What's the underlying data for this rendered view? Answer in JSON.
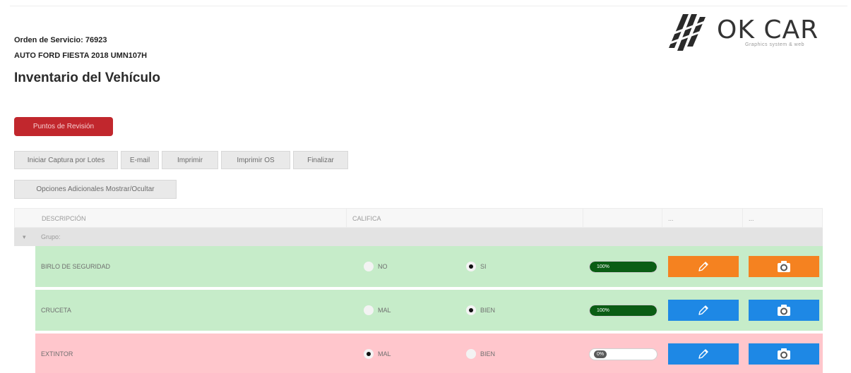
{
  "header": {
    "order": "Orden de Servicio: 76923",
    "vehicle": "AUTO FORD FIESTA 2018 UMN107H",
    "title": "Inventario del Vehículo"
  },
  "logo": {
    "name": "OK CAR",
    "tagline": "Graphics system & web"
  },
  "buttons": {
    "primary": "Puntos de Revisión",
    "toolbar": [
      "Iniciar Captura por Lotes",
      "E-mail",
      "Imprimir",
      "Imprimir OS",
      "Finalizar"
    ],
    "options": "Opciones Adicionales Mostrar/Ocultar"
  },
  "grid": {
    "columns": [
      "DESCRIPCIÓN",
      "CALIFICA",
      "",
      "...",
      "..."
    ],
    "group": {
      "toggle": "▾",
      "label": "Grupo:"
    },
    "rows": [
      {
        "description": "BIRLO DE SEGURIDAD",
        "option1": "NO",
        "option2": "SI",
        "selected": 2,
        "progress": 100,
        "progress_label": "100%",
        "status": "ok",
        "edit_color": "#f58220",
        "camera_color": "#f58220"
      },
      {
        "description": "CRUCETA",
        "option1": "MAL",
        "option2": "BIEN",
        "selected": 2,
        "progress": 100,
        "progress_label": "100%",
        "status": "ok",
        "edit_color": "#1e88e5",
        "camera_color": "#1e88e5"
      },
      {
        "description": "EXTINTOR",
        "option1": "MAL",
        "option2": "BIEN",
        "selected": 1,
        "progress": 0,
        "progress_label": "0%",
        "status": "bad",
        "edit_color": "#1e88e5",
        "camera_color": "#1e88e5"
      }
    ]
  },
  "colors": {
    "primary_button": "#c1272d",
    "row_ok": "#c6ecc9",
    "row_bad": "#ffc6cc",
    "progress_fill": "#0a5d14",
    "orange": "#f58220",
    "blue": "#1e88e5"
  },
  "icons": [
    "pencil-icon",
    "camera-icon",
    "ok-car-logo-mark"
  ]
}
